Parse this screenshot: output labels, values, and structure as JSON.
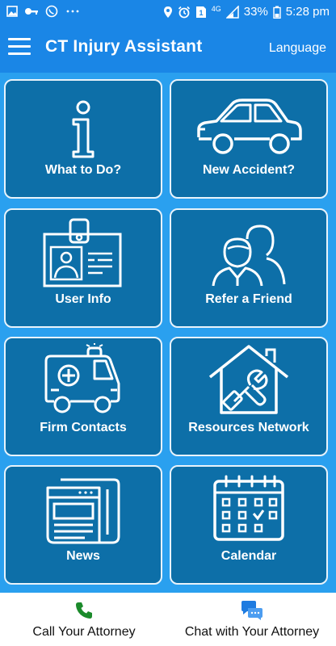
{
  "status_bar": {
    "left_icons": [
      "image-icon",
      "key-icon",
      "whatsapp-icon",
      "more-dots-icon"
    ],
    "right_icons": [
      "location-icon",
      "alarm-icon",
      "sim-icon",
      "lte-icon",
      "signal-icon"
    ],
    "network": "4G",
    "battery": "33%",
    "time": "5:28 pm"
  },
  "app_bar": {
    "title": "CT Injury Assistant",
    "language": "Language"
  },
  "tiles": [
    {
      "label": "What to Do?",
      "icon": "info-icon"
    },
    {
      "label": "New Accident?",
      "icon": "car-icon"
    },
    {
      "label": "User Info",
      "icon": "id-card-icon"
    },
    {
      "label": "Refer a Friend",
      "icon": "people-icon"
    },
    {
      "label": "Firm Contacts",
      "icon": "ambulance-icon"
    },
    {
      "label": "Resources Network",
      "icon": "house-tools-icon"
    },
    {
      "label": "News",
      "icon": "newspaper-icon"
    },
    {
      "label": "Calendar",
      "icon": "calendar-icon"
    }
  ],
  "bottom_bar": {
    "call": "Call Your Attorney",
    "chat": "Chat with Your Attorney"
  },
  "colors": {
    "primary": "#1a86e6",
    "tile_bg": "#0d6fa8",
    "grid_bg": "#2aa0ef",
    "phone_green": "#1b8a2b",
    "chat_blue": "#1e7be0"
  }
}
